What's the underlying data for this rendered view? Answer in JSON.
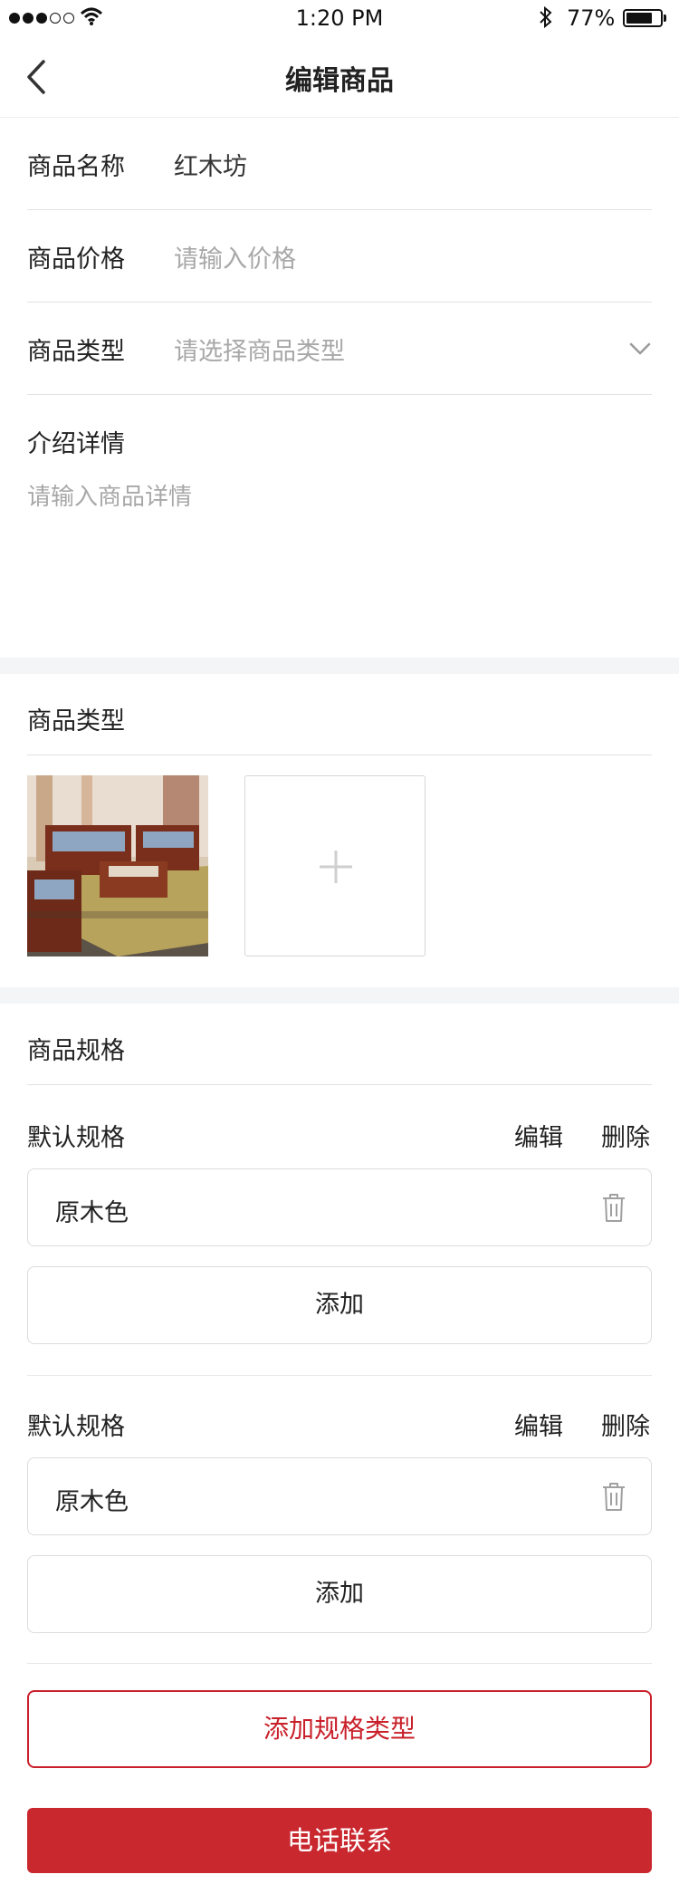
{
  "status_bar": {
    "time": "1:20 PM",
    "battery_percent": "77%",
    "battery_level": 0.77,
    "signal_bars_filled": 3,
    "signal_bars_total": 5
  },
  "nav": {
    "title": "编辑商品",
    "back_icon": "chevron-left-icon"
  },
  "form": {
    "name_label": "商品名称",
    "name_value": "红木坊",
    "price_label": "商品价格",
    "price_placeholder": "请输入价格",
    "type_label": "商品类型",
    "type_placeholder": "请选择商品类型",
    "detail_label": "介绍详情",
    "detail_placeholder": "请输入商品详情"
  },
  "images_section": {
    "title": "商品类型",
    "add_icon": "plus-icon"
  },
  "spec_section": {
    "title": "商品规格",
    "groups": [
      {
        "name": "默认规格",
        "edit_label": "编辑",
        "delete_label": "删除",
        "item": "原木色",
        "add_label": "添加"
      },
      {
        "name": "默认规格",
        "edit_label": "编辑",
        "delete_label": "删除",
        "item": "原木色",
        "add_label": "添加"
      }
    ]
  },
  "buttons": {
    "add_spec_type": "添加规格类型",
    "call": "电话联系"
  },
  "colors": {
    "accent_red": "#c9282f",
    "placeholder_gray": "#a8a8a8",
    "section_gap": "#f4f5f7"
  }
}
